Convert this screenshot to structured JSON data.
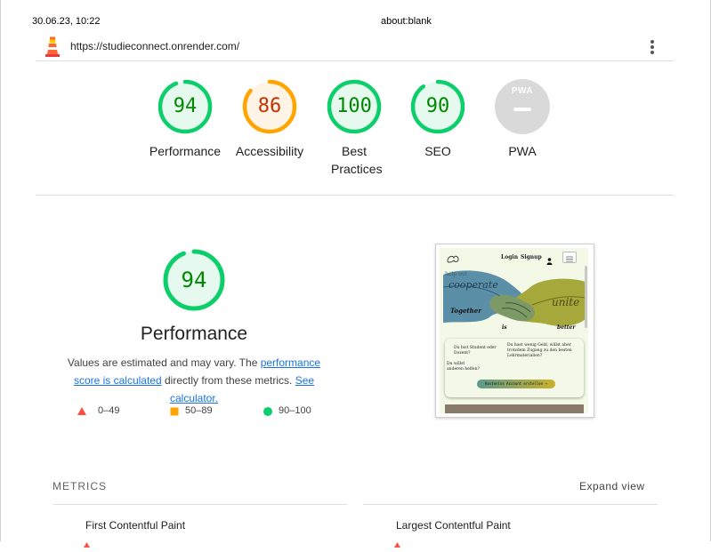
{
  "print_header": {
    "datetime": "30.06.23, 10:22",
    "page_title": "about:blank"
  },
  "topbar": {
    "url": "https://studieconnect.onrender.com/",
    "logo_icon": "lighthouse-icon",
    "menu_icon": "kebab-menu-icon"
  },
  "scores": [
    {
      "label": "Performance",
      "value": "94",
      "fraction": 0.94,
      "color": "#0cce6b",
      "text_color": "#008800",
      "bg": "#e6f9ee"
    },
    {
      "label": "Accessibility",
      "value": "86",
      "fraction": 0.86,
      "color": "#ffa400",
      "text_color": "#c33300",
      "bg": "#fff4e5"
    },
    {
      "label": "Best Practices",
      "value": "100",
      "fraction": 1.0,
      "color": "#0cce6b",
      "text_color": "#008800",
      "bg": "#e6f9ee"
    },
    {
      "label": "SEO",
      "value": "90",
      "fraction": 0.9,
      "color": "#0cce6b",
      "text_color": "#008800",
      "bg": "#e6f9ee"
    },
    {
      "label": "PWA",
      "value": "",
      "fraction": 0,
      "color": "#cccccc",
      "text_color": "#ffffff",
      "bg": "#d9d9d9",
      "badge_text": "PWA"
    }
  ],
  "performance": {
    "score": "94",
    "title": "Performance",
    "desc_prefix": "Values are estimated and may vary. The ",
    "desc_link1": "performance score is calculated",
    "desc_middle": " directly from these metrics. ",
    "desc_link2": "See calculator.",
    "legend": [
      {
        "range": "0–49",
        "icon": "red-triangle-icon"
      },
      {
        "range": "50–89",
        "icon": "orange-square-icon"
      },
      {
        "range": "90–100",
        "icon": "green-circle-icon"
      }
    ]
  },
  "screenshot": {
    "nav_login": "Login",
    "nav_signup": "Signup",
    "word_together": "Together",
    "word_is": "is",
    "word_better": "better",
    "word_cooperate": "cooperate",
    "word_unite": "unite",
    "card_q1": "Du bist Student oder Dozent?",
    "card_q2": "Du hast wenig Geld, willst aber trotzdem Zugang zu den besten Lehrmaterialien?",
    "card_q3": "Du willst anderen helfen?",
    "cta": "Kostenlos Account erstellen →"
  },
  "metrics": {
    "header": "METRICS",
    "expand": "Expand view",
    "items": [
      "First Contentful Paint",
      "Largest Contentful Paint"
    ]
  },
  "colors": {
    "pass": "#0cce6b",
    "average": "#ffa400",
    "fail": "#ff4e42",
    "link": "#1a73e8"
  }
}
